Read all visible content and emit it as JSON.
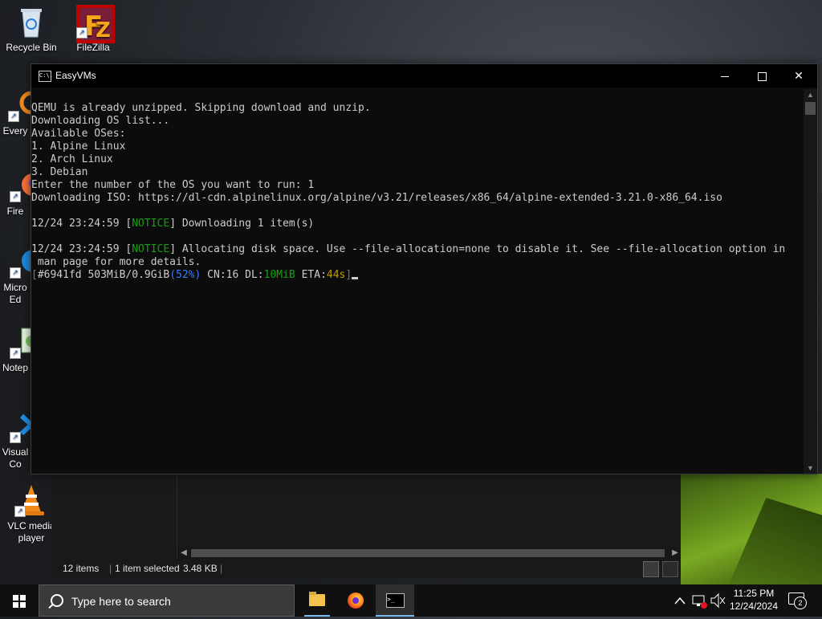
{
  "desktop": {
    "icons": [
      {
        "label": "Recycle Bin"
      },
      {
        "label": "FileZilla"
      },
      {
        "label": "Every"
      },
      {
        "label": "Fire"
      },
      {
        "label": "Micro Ed"
      },
      {
        "label": "Notep"
      },
      {
        "label": "Visual Co"
      },
      {
        "label": "VLC media player"
      }
    ]
  },
  "explorer": {
    "status": {
      "items_count": "12 items",
      "selected": "1 item selected",
      "size": "3.48 KB"
    }
  },
  "console": {
    "title": "EasyVMs",
    "icon_text": "C:\\.",
    "lines": {
      "l1": "QEMU is already unzipped. Skipping download and unzip.",
      "l2": "Downloading OS list...",
      "l3": "Available OSes:",
      "l4": "1. Alpine Linux",
      "l5": "2. Arch Linux",
      "l6": "3. Debian",
      "l7": "Enter the number of the OS you want to run: 1",
      "l8": "Downloading ISO: https://dl-cdn.alpinelinux.org/alpine/v3.21/releases/x86_64/alpine-extended-3.21.0-x86_64.iso",
      "n1_time": "12/24 23:24:59",
      "n1_tag": "NOTICE",
      "n1_msg": "Downloading 1 item(s)",
      "n2_time": "12/24 23:24:59",
      "n2_tag": "NOTICE",
      "n2_msg": "Allocating disk space. Use --file-allocation=none to disable it. See --file-allocation option in",
      "n2_cont": " man page for more details.",
      "prog_id": "#6941fd",
      "prog_size": "503MiB/0.9GiB",
      "prog_pct": "52%",
      "prog_cn": "CN:16",
      "prog_dl_label": "DL:",
      "prog_dl": "10MiB",
      "prog_eta_label": "ETA:",
      "prog_eta": "44s"
    }
  },
  "taskbar": {
    "search_placeholder": "Type here to search",
    "time": "11:25 PM",
    "date": "12/24/2024",
    "notification_count": "2"
  },
  "colors": {
    "notice": "#13a10e",
    "percent": "#3b78ff",
    "eta": "#c19c00",
    "taskbar": "#101010",
    "accent": "#76b9ed"
  }
}
